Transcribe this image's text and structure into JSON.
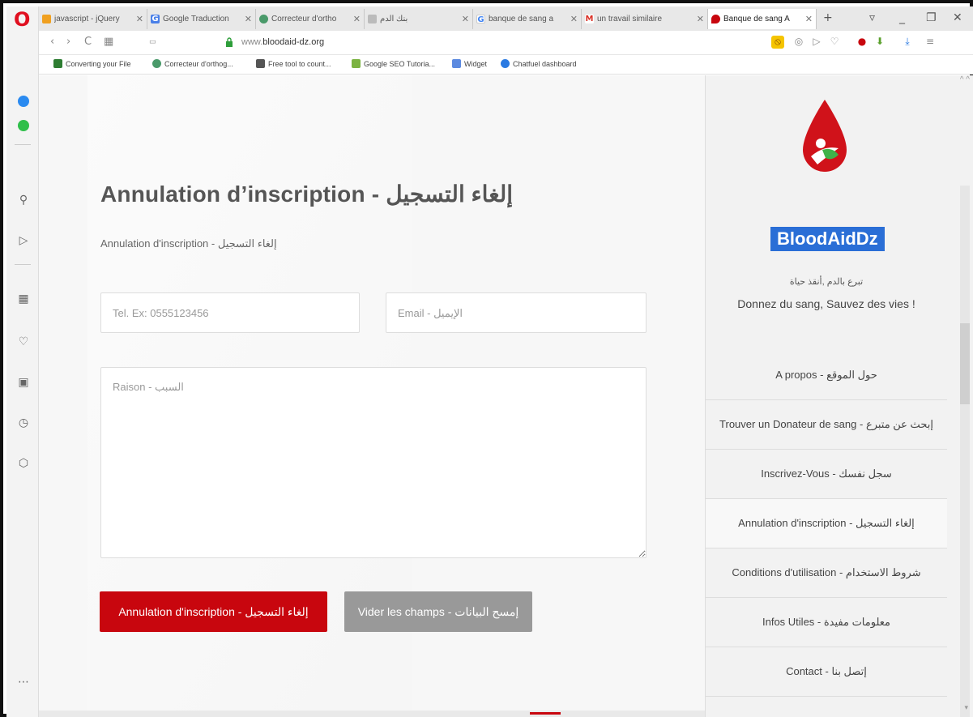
{
  "browser": {
    "tabs": [
      {
        "label": "javascript - jQuery",
        "fav_color": "#f0a020",
        "fav_glyph": ""
      },
      {
        "label": "Google Traduction",
        "fav_color": "#4a80e8",
        "fav_glyph": "G"
      },
      {
        "label": "Correcteur d'ortho",
        "fav_color": "#4a9a6a",
        "fav_glyph": ""
      },
      {
        "label": "بنك الدم",
        "fav_color": "#bbbbbb",
        "fav_glyph": ""
      },
      {
        "label": "banque de sang a",
        "fav_color": "#4285f4",
        "fav_glyph": "G"
      },
      {
        "label": "un travail similaire",
        "fav_color": "#d93025",
        "fav_glyph": "M"
      },
      {
        "label": "Banque de sang A",
        "fav_color": "#c8060e",
        "fav_glyph": "",
        "active": true
      }
    ],
    "new_tab": "+",
    "url_prefix": "www.",
    "url": "bloodaid-dz.org",
    "bookmarks": [
      {
        "label": "Converting your File",
        "color": "#2e7d32"
      },
      {
        "label": "Correcteur d'orthog...",
        "color": "#4a9a6a"
      },
      {
        "label": "Free tool to count...",
        "color": "#555555"
      },
      {
        "label": "Google SEO Tutoria...",
        "color": "#7cb342"
      },
      {
        "label": "Widget",
        "color": "#5c8ae0"
      },
      {
        "label": "Chatfuel dashboard",
        "color": "#2a7ae2"
      }
    ]
  },
  "form": {
    "title": "Annulation d’inscription - إلغاء التسجيل",
    "subtitle": "Annulation d'inscription - إلغاء التسجيل",
    "tel_placeholder": "Tel. Ex: 0555123456",
    "email_placeholder": "Email - الإيميل",
    "reason_placeholder": "Raison - السبب",
    "submit_label": "Annulation d'inscription - إلغاء التسجيل",
    "reset_label": "Vider les champs - إمسح البيانات"
  },
  "sidebar": {
    "brand": "BloodAidDz",
    "tagline_ar": "تبرع بالدم ,أنقذ حياة",
    "tagline_fr": "Donnez du sang, Sauvez des vies !",
    "menu": [
      {
        "label": "A propos - حول الموقع"
      },
      {
        "label": "Trouver un Donateur de sang - إبحث عن متبرع"
      },
      {
        "label": "Inscrivez-Vous - سجل نفسك"
      },
      {
        "label": "Annulation d'inscription - إلغاء التسجيل",
        "active": true
      },
      {
        "label": "Conditions d'utilisation - شروط الاستخدام"
      },
      {
        "label": "Infos Utiles - معلومات مفيدة"
      },
      {
        "label": "Contact - إتصل بنا"
      }
    ]
  },
  "colors": {
    "accent_red": "#c8060e",
    "brand_blue": "#2a6ed6",
    "button_gray": "#999999"
  }
}
